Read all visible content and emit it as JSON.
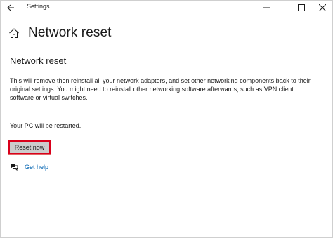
{
  "window": {
    "title": "Settings",
    "controls": {
      "minimize_icon": "minimize-icon",
      "maximize_icon": "maximize-icon",
      "close_icon": "close-icon"
    }
  },
  "header": {
    "back_icon": "back-arrow-icon",
    "home_icon": "home-icon",
    "title": "Network reset"
  },
  "section": {
    "heading": "Network reset",
    "description": "This will remove then reinstall all your network adapters, and set other networking components back to their original settings. You might need to reinstall other networking software afterwards, such as VPN client software or virtual switches.",
    "restart_note": "Your PC will be restarted."
  },
  "actions": {
    "reset_label": "Reset now",
    "highlight_color": "#d9001b"
  },
  "help": {
    "icon": "chat-help-icon",
    "label": "Get help",
    "link_color": "#0063b1"
  }
}
